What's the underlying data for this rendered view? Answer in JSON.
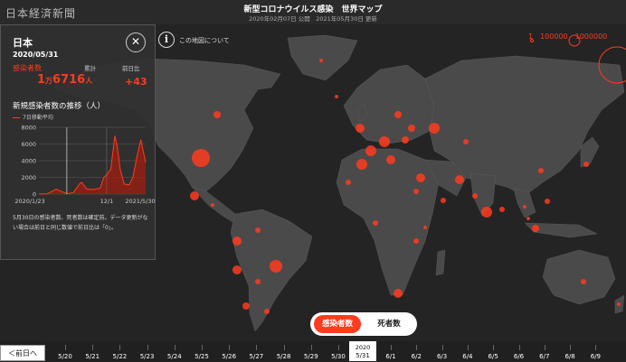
{
  "header": {
    "logo": "日本経済新聞",
    "title": "新型コロナウイルス感染　世界マップ",
    "dates": "2020年02月07日 公開　2021年05月30日 更新"
  },
  "map": {
    "info_label": "この地図について",
    "legend_text": "1　100000　1000000",
    "colors": {
      "background": "#242424",
      "land": "#4a4a4a",
      "marker": "#ff3b1f"
    }
  },
  "panel": {
    "country": "日本",
    "date": "2020/05/31",
    "cases_label": "感染者数",
    "total_label": "累計",
    "diff_label": "前日比",
    "total_main": "1",
    "total_unit": "万",
    "total_sub": "6716",
    "total_unit2": "人",
    "diff_value": "+43",
    "trend_title": "新規感染者数の推移（人）",
    "trend_legend": "7日移動平均",
    "note": "5月30日の感染者数、死者数は確定前。データ更新がない場合は前日と同じ数値で前日比は「0」。"
  },
  "chart_data": {
    "type": "area",
    "title": "新規感染者数の推移（人）",
    "y_ticks": [
      0,
      2000,
      4000,
      6000,
      8000
    ],
    "ylim": [
      0,
      8000
    ],
    "x_tick_labels": [
      "2020/1/23",
      "12/1",
      "2021/5/30"
    ],
    "series": [
      {
        "name": "7日移動平均",
        "x": [
          "2020-01-23",
          "2020-03-01",
          "2020-04-12",
          "2020-05-31",
          "2020-07-01",
          "2020-07-31",
          "2020-08-08",
          "2020-09-01",
          "2020-10-01",
          "2020-11-01",
          "2020-11-18",
          "2020-12-01",
          "2020-12-20",
          "2021-01-08",
          "2021-01-20",
          "2021-02-01",
          "2021-02-20",
          "2021-03-15",
          "2021-04-01",
          "2021-04-20",
          "2021-05-08",
          "2021-05-20",
          "2021-05-30"
        ],
        "values": [
          0,
          20,
          600,
          40,
          200,
          1300,
          1400,
          600,
          550,
          700,
          2000,
          2300,
          3000,
          7000,
          5500,
          3000,
          1200,
          1100,
          2000,
          4500,
          6500,
          5000,
          3800
        ]
      }
    ]
  },
  "toggle": {
    "cases": "感染者数",
    "deaths": "死者数"
  },
  "timeline": {
    "prev_label": "＜前日へ",
    "dates": [
      "5/20",
      "5/21",
      "5/22",
      "5/23",
      "5/24",
      "5/25",
      "5/26",
      "5/27",
      "5/28",
      "5/29",
      "5/30",
      "6/1",
      "6/2",
      "6/3",
      "6/4",
      "6/5",
      "6/6",
      "6/7",
      "6/8",
      "6/9"
    ],
    "current_year": "2020",
    "current_date": "5/31"
  }
}
